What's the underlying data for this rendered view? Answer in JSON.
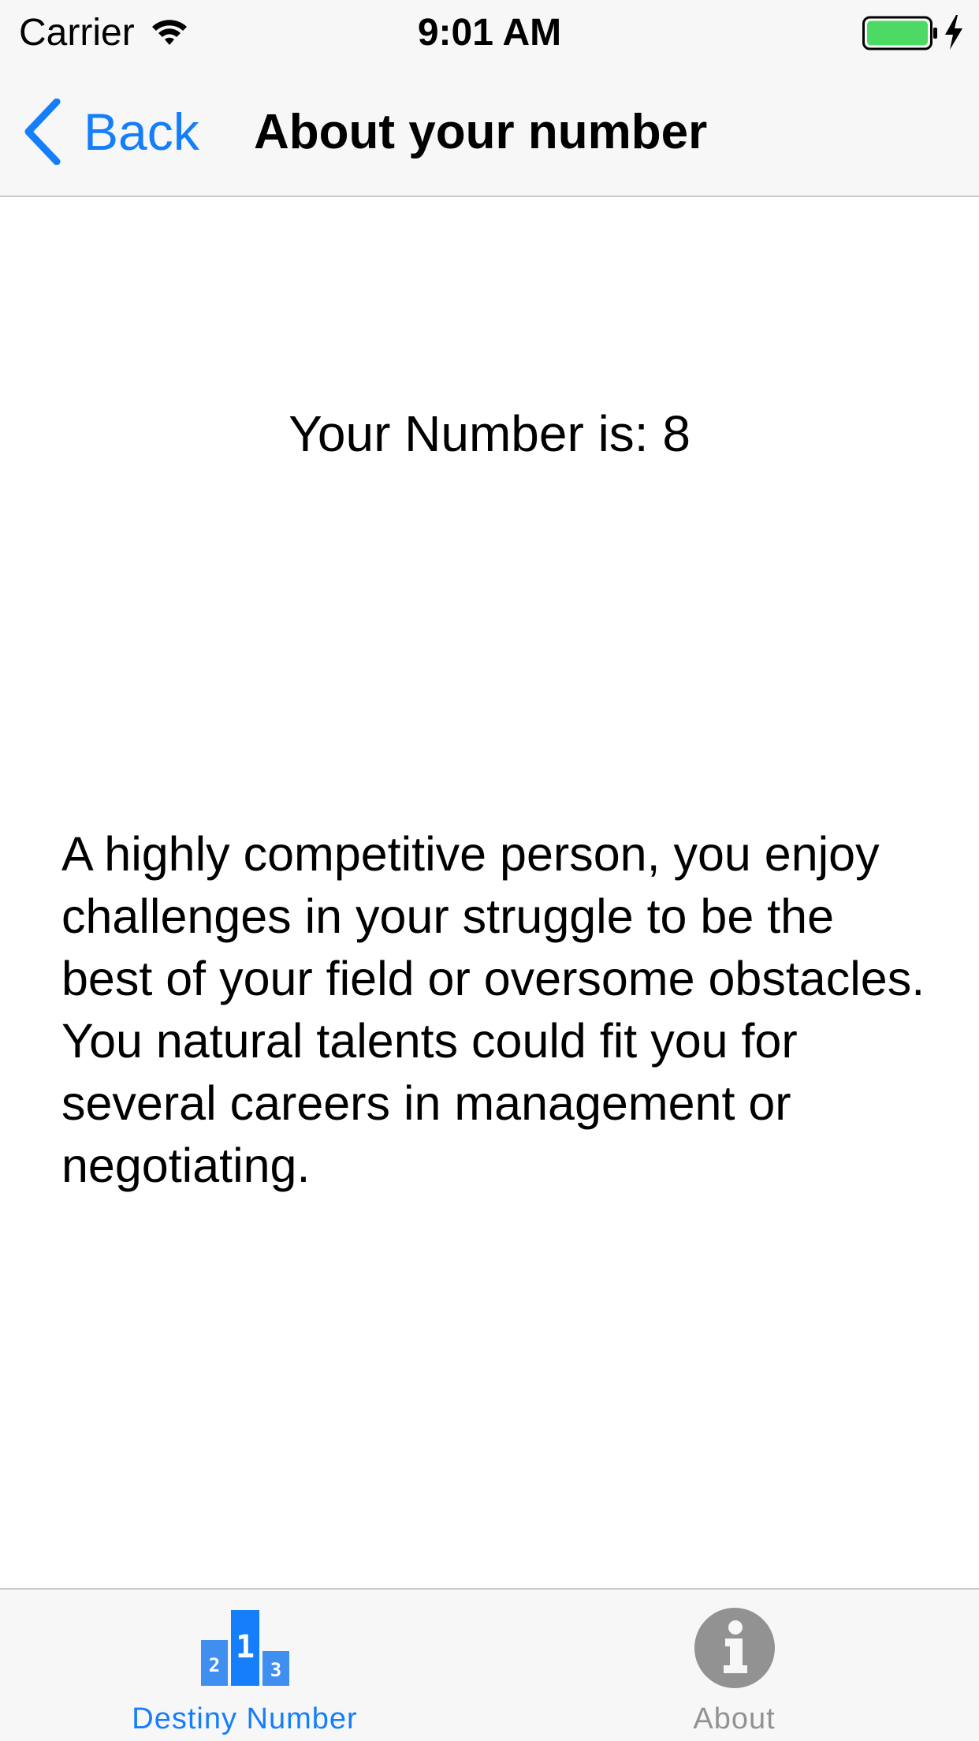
{
  "status_bar": {
    "carrier": "Carrier",
    "time": "9:01 AM",
    "icons": [
      "wifi-icon",
      "battery-icon",
      "charging-icon"
    ],
    "battery_color": "#4cd964"
  },
  "nav_bar": {
    "back_label": "Back",
    "title": "About your number",
    "accent_color": "#157efb"
  },
  "content": {
    "number_text": "Your Number is: 8",
    "description": "A highly competitive person, you enjoy challenges in your struggle to be the best of your field or oversome obstacles. You natural talents could fit you for several careers in management or negotiating."
  },
  "tab_bar": {
    "tabs": [
      {
        "label": "Destiny Number",
        "icon": "podium-icon",
        "selected": true,
        "color": "#157efb"
      },
      {
        "label": "About",
        "icon": "info-icon",
        "selected": false,
        "color": "#929292"
      }
    ]
  }
}
